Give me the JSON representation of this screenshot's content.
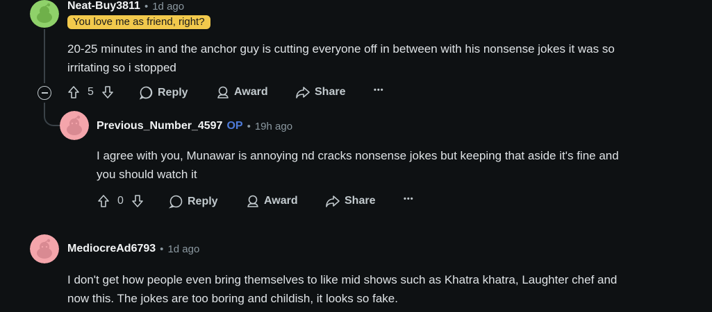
{
  "comments": [
    {
      "username": "Neat-Buy3811",
      "time": "1d ago",
      "flair": "You love me as friend, right?",
      "body": [
        "20-25 minutes in and the anchor guy is cutting everyone off in between with his nonsense jokes it was so",
        "irritating so i stopped"
      ],
      "score": "5",
      "reply_label": "Reply",
      "award_label": "Award",
      "share_label": "Share",
      "more_label": "•••",
      "avatar_color": "#8fd16a"
    },
    {
      "username": "Previous_Number_4597",
      "op_badge": "OP",
      "time": "19h ago",
      "body": [
        "I agree with you, Munawar is annoying nd cracks nonsense jokes but keeping that aside it's fine and",
        "you should watch it"
      ],
      "score": "0",
      "reply_label": "Reply",
      "award_label": "Award",
      "share_label": "Share",
      "more_label": "•••",
      "avatar_color": "#f4a5ab"
    },
    {
      "username": "MediocreAd6793",
      "time": "1d ago",
      "body": [
        "I don't get how people even bring themselves to like mid shows such as Khatra khatra, Laughter chef and",
        "now this. The jokes are too boring and childish, it looks so fake."
      ],
      "avatar_color": "#f4a5ab"
    }
  ],
  "separator": "•"
}
